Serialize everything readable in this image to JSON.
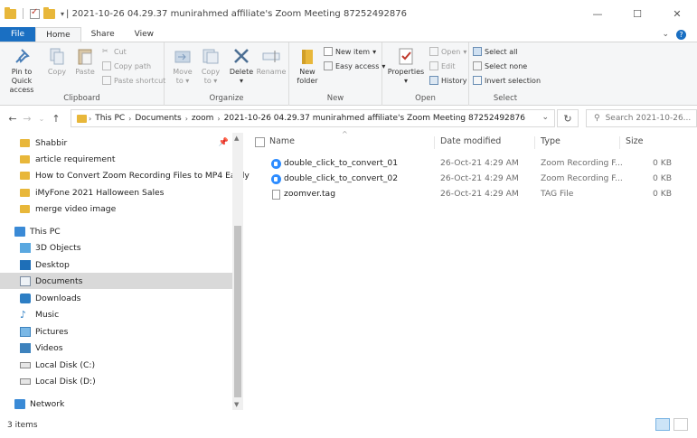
{
  "window": {
    "title": "| 2021-10-26 04.29.37 munirahmed affiliate's Zoom Meeting 87252492876",
    "minimize": "—",
    "maximize": "☐",
    "close": "✕"
  },
  "tabs": {
    "file": "File",
    "home": "Home",
    "share": "Share",
    "view": "View"
  },
  "ribbon": {
    "clipboard": {
      "label": "Clipboard",
      "pin_line1": "Pin to Quick",
      "pin_line2": "access",
      "copy": "Copy",
      "paste": "Paste",
      "cut": "Cut",
      "copy_path": "Copy path",
      "paste_shortcut": "Paste shortcut"
    },
    "organize": {
      "label": "Organize",
      "move_to": "Move",
      "move_to2": "to",
      "copy_to": "Copy",
      "copy_to2": "to",
      "delete": "Delete",
      "rename": "Rename"
    },
    "new": {
      "label": "New",
      "new_folder1": "New",
      "new_folder2": "folder",
      "new_item": "New item",
      "easy_access": "Easy access"
    },
    "open": {
      "label": "Open",
      "properties": "Properties",
      "open": "Open",
      "edit": "Edit",
      "history": "History"
    },
    "select": {
      "label": "Select",
      "select_all": "Select all",
      "select_none": "Select none",
      "invert": "Invert selection"
    }
  },
  "address": {
    "crumbs": [
      "This PC",
      "Documents",
      "zoom",
      "2021-10-26 04.29.37 munirahmed affiliate's Zoom Meeting 87252492876"
    ],
    "search_placeholder": "Search 2021-10-26..."
  },
  "nav": {
    "quick_access": [
      "Shabbir",
      "article requirement",
      "How  to Convert Zoom Recording Files to MP4 Easily",
      "iMyFone 2021 Halloween Sales",
      "merge video image"
    ],
    "this_pc": "This PC",
    "pc_items": [
      "3D Objects",
      "Desktop",
      "Documents",
      "Downloads",
      "Music",
      "Pictures",
      "Videos",
      "Local Disk (C:)",
      "Local Disk (D:)"
    ],
    "network": "Network"
  },
  "list": {
    "columns": [
      "Name",
      "Date modified",
      "Type",
      "Size"
    ],
    "rows": [
      {
        "name": "double_click_to_convert_01",
        "date": "26-Oct-21 4:29 AM",
        "type": "Zoom Recording F...",
        "size": "0 KB",
        "icon": "zoom-icon"
      },
      {
        "name": "double_click_to_convert_02",
        "date": "26-Oct-21 4:29 AM",
        "type": "Zoom Recording F...",
        "size": "0 KB",
        "icon": "zoom-icon"
      },
      {
        "name": "zoomver.tag",
        "date": "26-Oct-21 4:29 AM",
        "type": "TAG File",
        "size": "0 KB",
        "icon": "tag-file-icon"
      }
    ]
  },
  "status": {
    "items": "3 items"
  },
  "colors": {
    "accent": "#1a6fc2",
    "selection": "#cce4f7",
    "folder": "#e8b73a",
    "zoom": "#2d8cff"
  }
}
